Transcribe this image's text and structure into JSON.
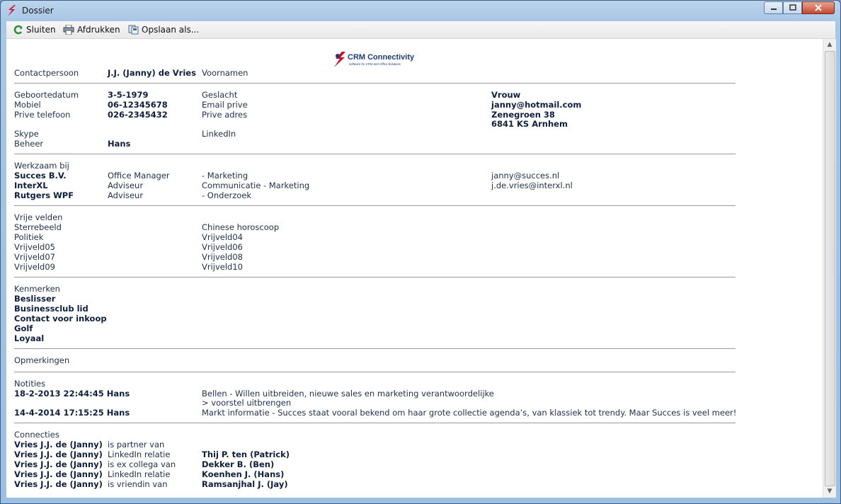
{
  "window": {
    "title": "Dossier"
  },
  "toolbar": {
    "close_label": "Sluiten",
    "print_label": "Afdrukken",
    "save_label": "Opslaan als..."
  },
  "logo": {
    "name": "CRM Connectivity",
    "tagline": "software for CRM and Office Solutions"
  },
  "contact": {
    "label": "Contactpersoon",
    "name": "J.J. (Janny) de Vries",
    "voornamen_label": "Voornamen",
    "geboortedatum_label": "Geboortedatum",
    "geboortedatum": "3-5-1979",
    "geslacht_label": "Geslacht",
    "geslacht": "Vrouw",
    "mobiel_label": "Mobiel",
    "mobiel": "06-12345678",
    "email_label": "Email prive",
    "email": "janny@hotmail.com",
    "telefoon_label": "Prive telefoon",
    "telefoon": "026-2345432",
    "adres_label": "Prive adres",
    "adres_line1": "Zenegroen 38",
    "adres_line2": "6841 KS Arnhem",
    "skype_label": "Skype",
    "linkedin_label": "LinkedIn",
    "beheer_label": "Beheer",
    "beheer": "Hans"
  },
  "werk": {
    "label": "Werkzaam bij",
    "rows": [
      {
        "company": "Succes B.V.",
        "role": "Office Manager",
        "dept": "- Marketing",
        "email": "janny@succes.nl"
      },
      {
        "company": "InterXL",
        "role": "Adviseur",
        "dept": "Communicatie - Marketing",
        "email": "j.de.vries@interxl.nl"
      },
      {
        "company": "Rutgers WPF",
        "role": "Adviseur",
        "dept": "- Onderzoek",
        "email": ""
      }
    ]
  },
  "vrije": {
    "label": "Vrije velden",
    "left": [
      "Sterrebeeld",
      "Politiek",
      "Vrijveld05",
      "Vrijveld07",
      "Vrijveld09"
    ],
    "right": [
      "Chinese horoscoop",
      "Vrijveld04",
      "Vrijveld06",
      "Vrijveld08",
      "Vrijveld10"
    ]
  },
  "kenmerken": {
    "label": "Kenmerken",
    "items": [
      "Beslisser",
      "Businessclub lid",
      "Contact voor inkoop",
      "Golf",
      "Loyaal"
    ]
  },
  "opmerkingen": {
    "label": "Opmerkingen"
  },
  "notities": {
    "label": "Notities",
    "items": [
      {
        "datetime": "18-2-2013 22:44:45 Hans",
        "line1": "Bellen - Willen uitbreiden, nieuwe sales en marketing verantwoordelijke",
        "line2": "> voorstel uitbrengen"
      },
      {
        "datetime": "14-4-2014 17:15:25 Hans",
        "line1": "Markt informatie - Succes staat vooral bekend om haar grote collectie agenda’s, van klassiek tot trendy. Maar Succes is veel meer!",
        "line2": ""
      }
    ]
  },
  "connecties": {
    "label": "Connecties",
    "items": [
      {
        "person": "Vries J.J. de (Janny)",
        "relation": "is partner van",
        "other": ""
      },
      {
        "person": "Vries J.J. de (Janny)",
        "relation": "LinkedIn relatie",
        "other": "Thij P. ten (Patrick)"
      },
      {
        "person": "Vries J.J. de (Janny)",
        "relation": "is ex collega van",
        "other": "Dekker B. (Ben)"
      },
      {
        "person": "Vries J.J. de (Janny)",
        "relation": "LinkedIn relatie",
        "other": "Koenhen J. (Hans)"
      },
      {
        "person": "Vries J.J. de (Janny)",
        "relation": "is vriendin van",
        "other": "Ramsanjhal J. (Jay)"
      }
    ]
  },
  "colors": {
    "accent": "#c8102e",
    "text": "#1f2f4a",
    "bold": "#0f1f3d"
  }
}
